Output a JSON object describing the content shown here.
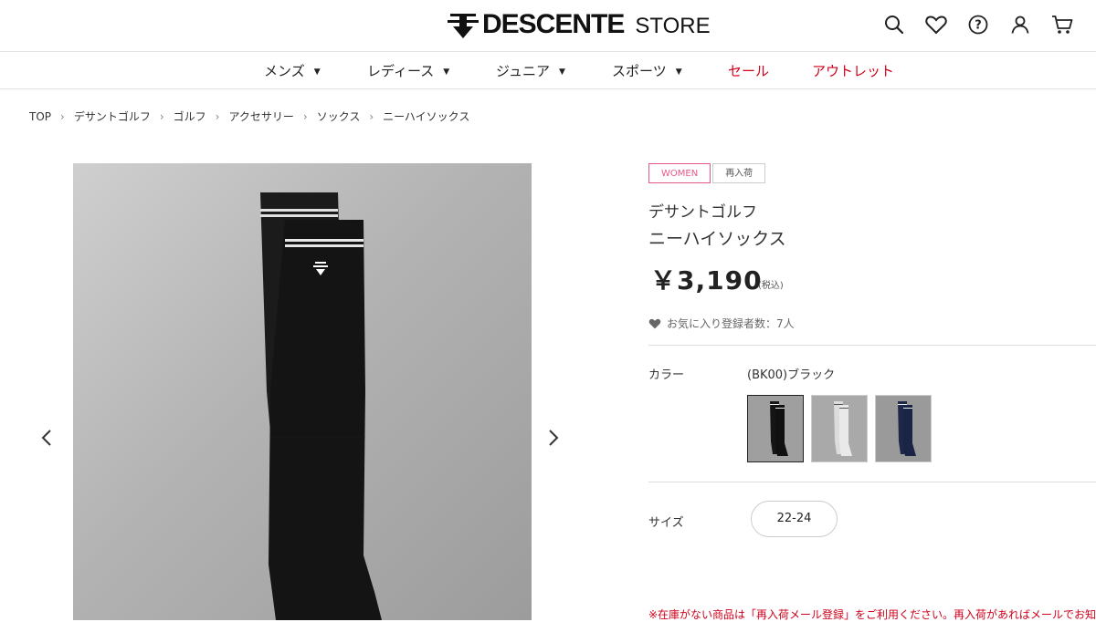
{
  "header": {
    "logo_text": "DESCENTE",
    "logo_store": "STORE",
    "icons": [
      "search-icon",
      "heart-icon",
      "help-icon",
      "account-icon",
      "cart-icon"
    ]
  },
  "nav": {
    "items": [
      {
        "label": "メンズ",
        "dropdown": true
      },
      {
        "label": "レディース",
        "dropdown": true
      },
      {
        "label": "ジュニア",
        "dropdown": true
      },
      {
        "label": "スポーツ",
        "dropdown": true
      },
      {
        "label": "セール",
        "dropdown": false,
        "color": "#d0021b"
      },
      {
        "label": "アウトレット",
        "dropdown": false,
        "color": "#d0021b"
      }
    ]
  },
  "breadcrumb": [
    "TOP",
    "デサントゴルフ",
    "ゴルフ",
    "アクセサリー",
    "ソックス",
    "ニーハイソックス"
  ],
  "product": {
    "badges": [
      "WOMEN",
      "再入荷"
    ],
    "brand": "デサントゴルフ",
    "name": "ニーハイソックス",
    "price": "￥3,190",
    "tax": "(税込)",
    "favorites": "お気に入り登録者数：7人",
    "color_label": "カラー",
    "color_value": "(BK00)ブラック",
    "swatches": [
      {
        "name": "black",
        "color": "#1a1a1a"
      },
      {
        "name": "white",
        "color": "#e8e8e8"
      },
      {
        "name": "navy",
        "color": "#1f2a4a"
      }
    ],
    "size_label": "サイズ",
    "sizes": [
      "22-24"
    ],
    "notice": "※在庫がない商品は「再入荷メール登録」をご利用ください。再入荷があればメールでお知"
  },
  "colors": {
    "accent_red": "#d0021b",
    "badge_pink": "#e8578a"
  }
}
